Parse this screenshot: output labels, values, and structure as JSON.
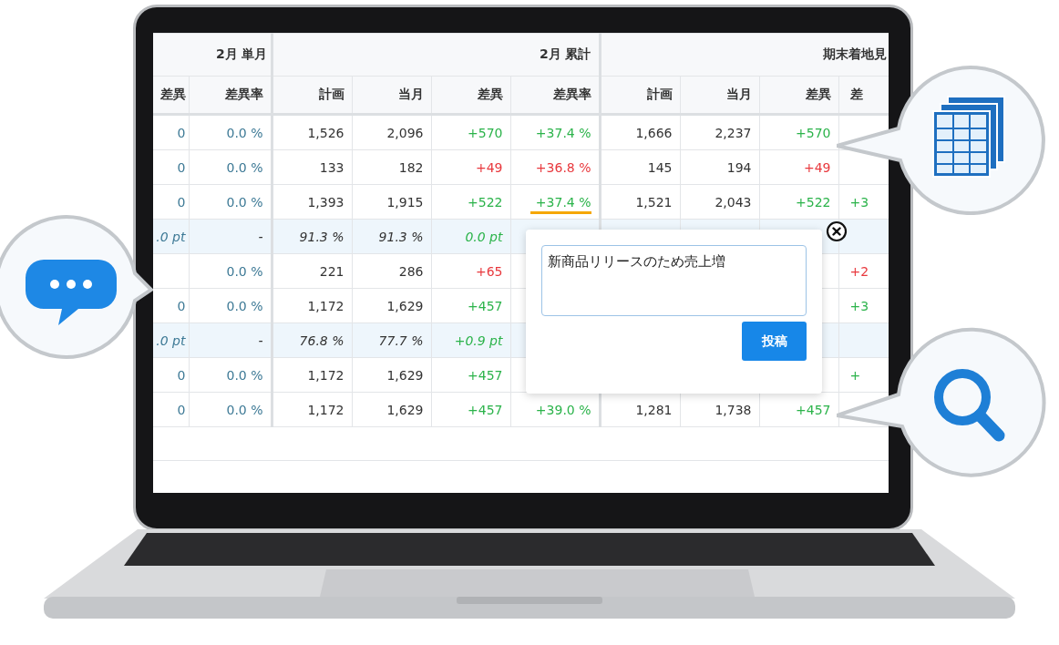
{
  "table": {
    "group_headers": [
      {
        "label": "2月 単月"
      },
      {
        "label": "2月 累計"
      },
      {
        "label": "期末着地見"
      }
    ],
    "columns": [
      "差異",
      "差異率",
      "計画",
      "当月",
      "差異",
      "差異率",
      "計画",
      "当月",
      "差異",
      "差"
    ],
    "rows": [
      {
        "kind": "value",
        "cells": [
          {
            "text": "0",
            "kind": "muted"
          },
          {
            "text": "0.0 %",
            "kind": "muted"
          },
          {
            "text": "1,526",
            "kind": "plain"
          },
          {
            "text": "2,096",
            "kind": "plain"
          },
          {
            "text": "+570",
            "kind": "positive"
          },
          {
            "text": "+37.4 %",
            "kind": "positive"
          },
          {
            "text": "1,666",
            "kind": "plain"
          },
          {
            "text": "2,237",
            "kind": "plain"
          },
          {
            "text": "+570",
            "kind": "positive"
          },
          null
        ]
      },
      {
        "kind": "value",
        "cells": [
          {
            "text": "0",
            "kind": "muted"
          },
          {
            "text": "0.0 %",
            "kind": "muted"
          },
          {
            "text": "133",
            "kind": "plain"
          },
          {
            "text": "182",
            "kind": "plain"
          },
          {
            "text": "+49",
            "kind": "negative"
          },
          {
            "text": "+36.8 %",
            "kind": "negative"
          },
          {
            "text": "145",
            "kind": "plain"
          },
          {
            "text": "194",
            "kind": "plain"
          },
          {
            "text": "+49",
            "kind": "negative"
          },
          null
        ]
      },
      {
        "kind": "value",
        "cells": [
          {
            "text": "0",
            "kind": "muted"
          },
          {
            "text": "0.0 %",
            "kind": "muted"
          },
          {
            "text": "1,393",
            "kind": "plain"
          },
          {
            "text": "1,915",
            "kind": "plain"
          },
          {
            "text": "+522",
            "kind": "positive"
          },
          {
            "text": "+37.4 %",
            "kind": "positive",
            "underlined": true
          },
          {
            "text": "1,521",
            "kind": "plain"
          },
          {
            "text": "2,043",
            "kind": "plain"
          },
          {
            "text": "+522",
            "kind": "positive"
          },
          {
            "text": "+3",
            "kind": "positive"
          }
        ]
      },
      {
        "kind": "ratio",
        "cells": [
          {
            "text": ".0 pt",
            "kind": "muted"
          },
          {
            "text": "-",
            "kind": "plain"
          },
          {
            "text": "91.3 %",
            "kind": "plain"
          },
          {
            "text": "91.3 %",
            "kind": "plain"
          },
          {
            "text": "0.0 pt",
            "kind": "positive"
          },
          null,
          null,
          null,
          null,
          null
        ]
      },
      {
        "kind": "value",
        "cells": [
          null,
          {
            "text": "0.0 %",
            "kind": "muted"
          },
          {
            "text": "221",
            "kind": "plain"
          },
          {
            "text": "286",
            "kind": "plain"
          },
          {
            "text": "+65",
            "kind": "negative"
          },
          null,
          null,
          null,
          null,
          {
            "text": "+2",
            "kind": "negative"
          }
        ]
      },
      {
        "kind": "value",
        "cells": [
          {
            "text": "0",
            "kind": "muted"
          },
          {
            "text": "0.0 %",
            "kind": "muted"
          },
          {
            "text": "1,172",
            "kind": "plain"
          },
          {
            "text": "1,629",
            "kind": "plain"
          },
          {
            "text": "+457",
            "kind": "positive"
          },
          null,
          null,
          null,
          null,
          {
            "text": "+3",
            "kind": "positive"
          }
        ]
      },
      {
        "kind": "ratio",
        "cells": [
          {
            "text": ".0 pt",
            "kind": "muted"
          },
          {
            "text": "-",
            "kind": "plain"
          },
          {
            "text": "76.8 %",
            "kind": "plain"
          },
          {
            "text": "77.7 %",
            "kind": "plain"
          },
          {
            "text": "+0.9 pt",
            "kind": "positive"
          },
          null,
          null,
          null,
          null,
          null
        ]
      },
      {
        "kind": "value",
        "cells": [
          {
            "text": "0",
            "kind": "muted"
          },
          {
            "text": "0.0 %",
            "kind": "muted"
          },
          {
            "text": "1,172",
            "kind": "plain"
          },
          {
            "text": "1,629",
            "kind": "plain"
          },
          {
            "text": "+457",
            "kind": "positive"
          },
          null,
          null,
          null,
          null,
          {
            "text": "+",
            "kind": "positive"
          }
        ]
      },
      {
        "kind": "value",
        "cells": [
          {
            "text": "0",
            "kind": "muted"
          },
          {
            "text": "0.0 %",
            "kind": "muted"
          },
          {
            "text": "1,172",
            "kind": "plain"
          },
          {
            "text": "1,629",
            "kind": "plain"
          },
          {
            "text": "+457",
            "kind": "positive"
          },
          {
            "text": "+39.0 %",
            "kind": "positive"
          },
          {
            "text": "1,281",
            "kind": "plain"
          },
          {
            "text": "1,738",
            "kind": "plain"
          },
          {
            "text": "+457",
            "kind": "positive"
          },
          null
        ]
      }
    ]
  },
  "comment_popup": {
    "value": "新商品リリースのため売上増",
    "button": "投稿"
  }
}
